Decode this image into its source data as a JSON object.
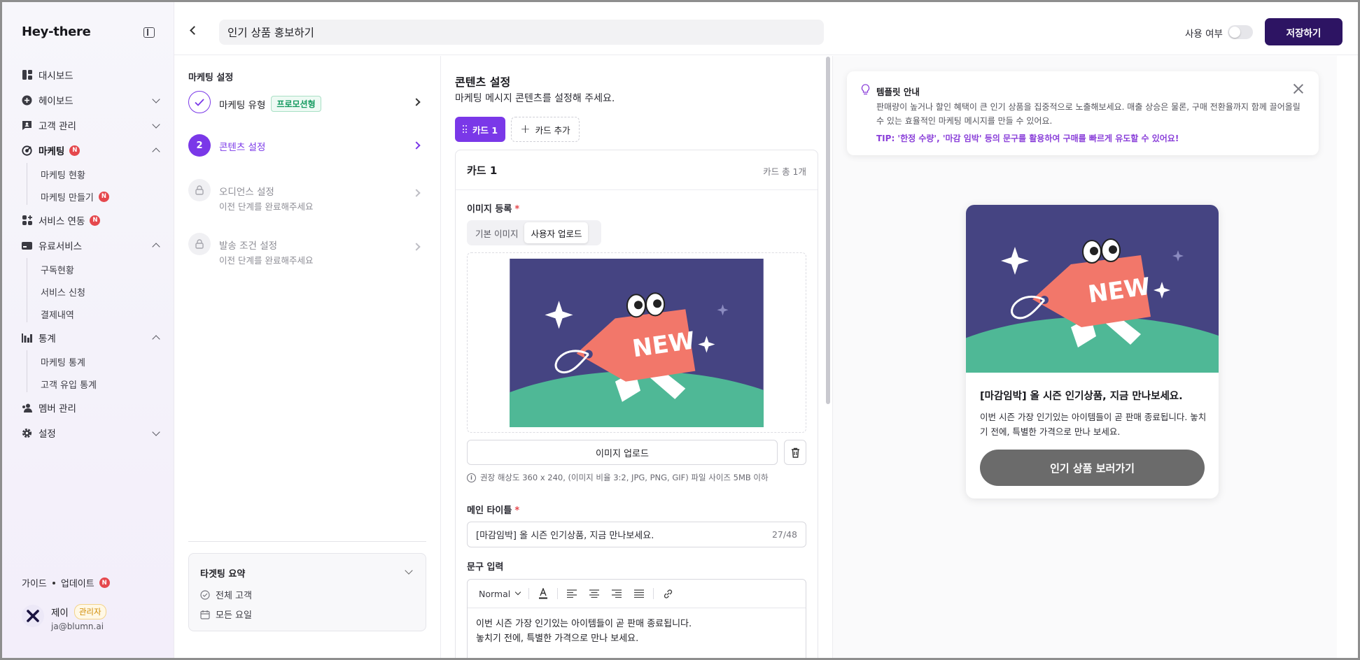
{
  "app": {
    "logo": "Hey-there"
  },
  "sidebar": {
    "items": [
      {
        "label": "대시보드"
      },
      {
        "label": "헤이보드"
      },
      {
        "label": "고객 관리"
      },
      {
        "label": "마케팅",
        "badge": "N"
      },
      {
        "label": "서비스 연동",
        "badge": "N"
      },
      {
        "label": "유료서비스"
      },
      {
        "label": "통계"
      },
      {
        "label": "멤버 관리"
      },
      {
        "label": "설정"
      }
    ],
    "marketing_sub": [
      {
        "label": "마케팅 현황"
      },
      {
        "label": "마케팅 만들기",
        "badge": "N"
      }
    ],
    "paid_sub": [
      {
        "label": "구독현황"
      },
      {
        "label": "서비스 신청"
      },
      {
        "label": "결제내역"
      }
    ],
    "stats_sub": [
      {
        "label": "마케팅 통계"
      },
      {
        "label": "고객 유입 통계"
      }
    ],
    "footer": {
      "guide": "가이드",
      "update": "업데이트",
      "badge": "N"
    },
    "user": {
      "name": "제이",
      "role": "관리자",
      "email": "ja@blumn.ai"
    }
  },
  "topbar": {
    "title_value": "인기 상품 홍보하기",
    "toggle_label": "사용 여부",
    "save_label": "저장하기"
  },
  "steps": {
    "section_title": "마케팅 설정",
    "items": [
      {
        "label": "마케팅 유형",
        "tag": "프로모션형"
      },
      {
        "label": "콘텐츠 설정",
        "number": "2"
      },
      {
        "label": "오디언스 설정",
        "sub": "이전 단계를 완료해주세요"
      },
      {
        "label": "발송 조건 설정",
        "sub": "이전 단계를 완료해주세요"
      }
    ],
    "summary": {
      "title": "타겟팅 요약",
      "rows": [
        "전체 고객",
        "모든 요일"
      ]
    }
  },
  "content": {
    "title": "콘텐츠 설정",
    "desc": "마케팅 메시지 콘텐츠를 설정해 주세요.",
    "card_tab": "카드 1",
    "add_card": "카드 추가",
    "card_name": "카드 1",
    "card_count": "카드 총 1개",
    "image_label": "이미지 등록",
    "seg_default": "기본 이미지",
    "seg_user": "사용자 업로드",
    "upload_label": "이미지 업로드",
    "hint": "권장 해상도 360 x 240, (이미지 비율 3:2, JPG, PNG, GIF) 파일 사이즈 5MB 이하",
    "main_title_label": "메인 타이틀",
    "main_title_value": "[마감임박] 올 시즌 인기상품, 지금 만나보세요.",
    "main_title_count": "27/48",
    "text_label": "문구 입력",
    "format_select": "Normal",
    "text_line1": "이번 시즌 가장 인기있는 아이템들이 곧 판매 종료됩니다.",
    "text_line2": "놓치기 전에, 특별한 가격으로 만나 보세요."
  },
  "preview": {
    "notice_title": "템플릿 안내",
    "notice_body": "판매량이 높거나 할인 혜택이 큰 인기 상품을 집중적으로 노출해보세요. 매출 상승은 물론, 구매 전환율까지 함께 끌어올릴 수 있는 효율적인 마케팅 메시지를 만들 수 있어요.",
    "notice_tip": "TIP: '한정 수량', '마감 임박' 등의 문구를 활용하여 구매를 빠르게 유도할 수 있어요!",
    "card_title": "[마감임박] 올 시즌 인기상품, 지금 만나보세요.",
    "card_body": "이번 시즌 가장 인기있는 아이템들이 곧 판매 종료됩니다. 놓치기 전에, 특별한 가격으로 만나 보세요.",
    "cta_label": "인기 상품 보러가기",
    "image_tag_text": "NEW"
  },
  "colors": {
    "brand": "#2d1463",
    "accent": "#7a38e8",
    "image_bg": "#454482",
    "tag": "#f2776a",
    "ground": "#4fb896"
  }
}
